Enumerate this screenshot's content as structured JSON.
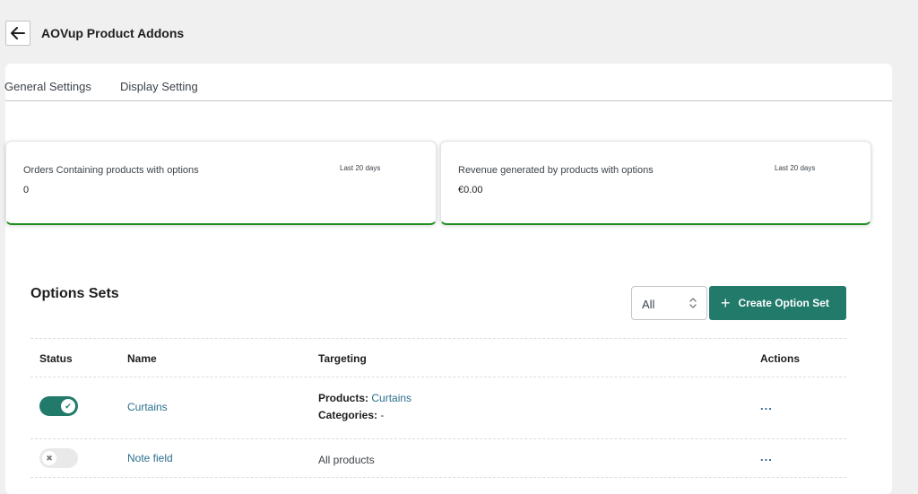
{
  "header": {
    "back_icon": "arrow-left-icon",
    "title": "AOVup Product Addons"
  },
  "tabs": [
    {
      "label": "General Settings"
    },
    {
      "label": "Display Setting"
    }
  ],
  "stats": [
    {
      "label": "Orders Containing products with options",
      "period": "Last 20 days",
      "value": "0"
    },
    {
      "label": "Revenue generated by products with options",
      "period": "Last 20 days",
      "value": "€0.00"
    }
  ],
  "options": {
    "title": "Options Sets",
    "filter_value": "All",
    "create_label": "Create Option Set",
    "columns": {
      "status": "Status",
      "name": "Name",
      "targeting": "Targeting",
      "actions": "Actions"
    },
    "rows": [
      {
        "enabled": true,
        "name": "Curtains",
        "products_label": "Products:",
        "products_value": "Curtains",
        "categories_label": "Categories:",
        "categories_value": "-",
        "actions": "..."
      },
      {
        "enabled": false,
        "name": "Note field",
        "targeting": "All products",
        "actions": "..."
      }
    ]
  },
  "colors": {
    "accent": "#227a6b",
    "link": "#2a6f8c",
    "success_border": "#1f8f1f"
  }
}
